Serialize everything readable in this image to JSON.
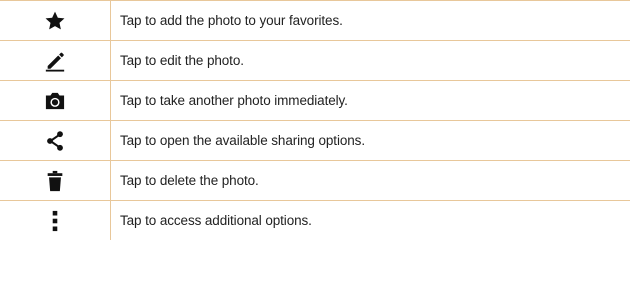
{
  "rows": [
    {
      "icon": "star-icon",
      "text": "Tap to add the photo to your favorites."
    },
    {
      "icon": "edit-pencil-icon",
      "text": "Tap to edit the photo."
    },
    {
      "icon": "camera-icon",
      "text": "Tap to take another photo immediately."
    },
    {
      "icon": "share-icon",
      "text": "Tap to open the available sharing options."
    },
    {
      "icon": "trash-icon",
      "text": "Tap to delete the photo."
    },
    {
      "icon": "more-options-icon",
      "text": "Tap to access additional options."
    }
  ],
  "colors": {
    "rule": "#e8c79a",
    "icon": "#111111",
    "text": "#222222"
  }
}
